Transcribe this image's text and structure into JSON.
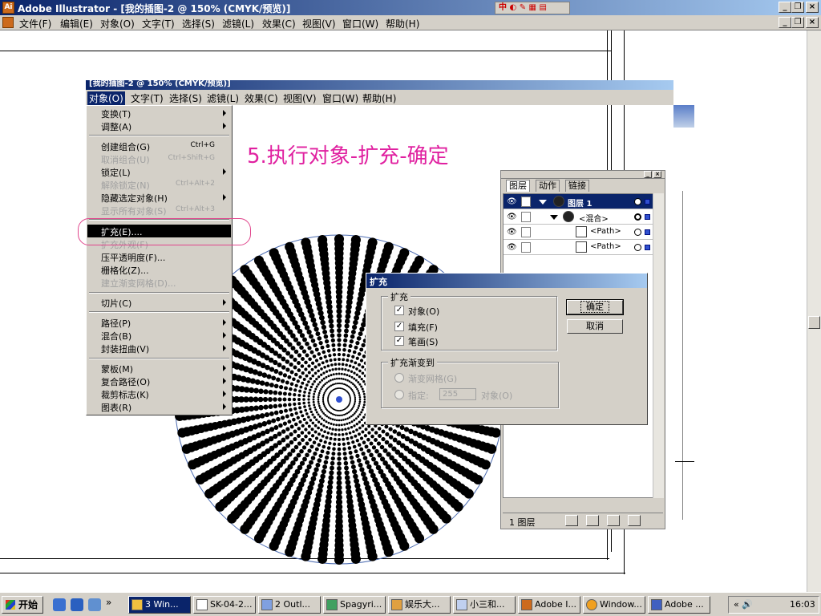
{
  "window": {
    "title": "Adobe Illustrator - [我的插图-2 @ 150% (CMYK/预览)]",
    "app_icon": "Ai",
    "ime": "中 ◐ ✎ ▦ ▤",
    "controls": {
      "minimize": "_",
      "maximize": "□",
      "close": "×",
      "restore": "❐"
    }
  },
  "menubar": {
    "items": [
      "文件(F)",
      "编辑(E)",
      "对象(O)",
      "文字(T)",
      "选择(S)",
      "滤镜(L)",
      "效果(C)",
      "视图(V)",
      "窗口(W)",
      "帮助(H)"
    ]
  },
  "inner_window": {
    "title": "[我的插图-2 @ 150% (CMYK/预览)]",
    "menubar": [
      "对象(O)",
      "文字(T)",
      "选择(S)",
      "滤镜(L)",
      "效果(C)",
      "视图(V)",
      "窗口(W)",
      "帮助(H)"
    ]
  },
  "object_menu": {
    "groups": [
      [
        {
          "label": "变换(T)",
          "submenu": true
        },
        {
          "label": "调整(A)",
          "submenu": true
        }
      ],
      [
        {
          "label": "创建组合(G)",
          "shortcut": "Ctrl+G"
        },
        {
          "label": "取消组合(U)",
          "shortcut": "Ctrl+Shift+G",
          "disabled": true
        },
        {
          "label": "锁定(L)",
          "submenu": true
        },
        {
          "label": "解除锁定(N)",
          "shortcut": "Ctrl+Alt+2",
          "disabled": true
        },
        {
          "label": "隐藏选定对象(H)",
          "submenu": true
        },
        {
          "label": "显示所有对象(S)",
          "shortcut": "Ctrl+Alt+3",
          "disabled": true
        }
      ],
      [
        {
          "label": "扩充(E)....",
          "highlighted": true
        },
        {
          "label": "扩充外观(F)",
          "disabled": true
        },
        {
          "label": "压平透明度(F)..."
        },
        {
          "label": "栅格化(Z)..."
        },
        {
          "label": "建立渐变网格(D)...",
          "disabled": true
        }
      ],
      [
        {
          "label": "切片(C)",
          "submenu": true
        }
      ],
      [
        {
          "label": "路径(P)",
          "submenu": true
        },
        {
          "label": "混合(B)",
          "submenu": true
        },
        {
          "label": "封装扭曲(V)",
          "submenu": true
        }
      ],
      [
        {
          "label": "蒙板(M)",
          "submenu": true
        },
        {
          "label": "复合路径(O)",
          "submenu": true
        },
        {
          "label": "裁剪标志(K)",
          "submenu": true
        },
        {
          "label": "图表(R)",
          "submenu": true
        }
      ]
    ]
  },
  "step_caption": "5.执行对象-扩充-确定",
  "layers_panel": {
    "tabs": [
      "图层",
      "动作",
      "链接"
    ],
    "rows": [
      {
        "name": "图层 1",
        "level": 0,
        "selected": true
      },
      {
        "name": "<混合>",
        "level": 1
      },
      {
        "name": "<Path>",
        "level": 2
      },
      {
        "name": "<Path>",
        "level": 2
      }
    ],
    "status": "1 图层"
  },
  "expand_dialog": {
    "title": "扩充",
    "expand_group": {
      "title": "扩充",
      "options": [
        {
          "label": "对象(O)",
          "checked": true
        },
        {
          "label": "填充(F)",
          "checked": true
        },
        {
          "label": "笔画(S)",
          "checked": true
        }
      ]
    },
    "gradient_group": {
      "title": "扩充渐变到",
      "mesh_label": "渐变网格(G)",
      "specify_label": "指定:",
      "specify_value": "255",
      "specify_unit": "对象(O)"
    },
    "ok_label": "确定",
    "cancel_label": "取消"
  },
  "taskbar": {
    "start_label": "开始",
    "tasks": [
      "3 Win...",
      "SK-04-2...",
      "2 Outl...",
      "Spagyri...",
      "娱乐大...",
      "小三和...",
      "Adobe I...",
      "Window...",
      "Adobe ..."
    ],
    "active_task": 0,
    "tray_glyphs": "« 🔊",
    "clock": "16:03"
  },
  "colors": {
    "caption": "#e020a0",
    "annotation": "#e0468c",
    "titlebar": "#0a246a"
  }
}
